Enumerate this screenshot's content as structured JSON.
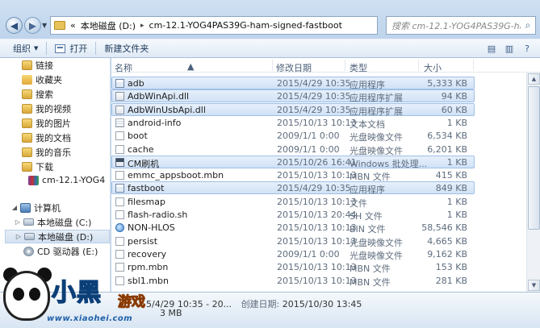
{
  "address": {
    "prefix": "«",
    "crumbs": [
      "本地磁盘 (D:)",
      "cm-12.1-YOG4PAS39G-ham-signed-fastboot"
    ],
    "separator": "▸"
  },
  "search": {
    "placeholder": "搜索 cm-12.1-YOG4PAS39G-ham-s..."
  },
  "toolbar": {
    "organize": "组织",
    "open": "打开",
    "new_folder": "新建文件夹"
  },
  "nav": {
    "items": [
      {
        "label": "链接",
        "icon": "link-folder-icon"
      },
      {
        "label": "收藏夹",
        "icon": "favorites-icon"
      },
      {
        "label": "搜索",
        "icon": "search-folder-icon"
      },
      {
        "label": "我的视频",
        "icon": "videos-icon"
      },
      {
        "label": "我的图片",
        "icon": "pictures-icon"
      },
      {
        "label": "我的文档",
        "icon": "documents-icon"
      },
      {
        "label": "我的音乐",
        "icon": "music-icon"
      },
      {
        "label": "下载",
        "icon": "downloads-icon"
      },
      {
        "label": "cm-12.1-YOG4",
        "icon": "rar-archive-icon"
      },
      {
        "label": "计算机",
        "icon": "computer-icon"
      },
      {
        "label": "本地磁盘 (C:)",
        "icon": "drive-icon"
      },
      {
        "label": "本地磁盘 (D:)",
        "icon": "drive-icon"
      },
      {
        "label": "CD 驱动器 (E:)",
        "icon": "cd-drive-icon"
      },
      {
        "label": "网",
        "icon": "network-icon"
      }
    ]
  },
  "columns": {
    "name": "名称",
    "date": "修改日期",
    "type": "类型",
    "size": "大小"
  },
  "files": [
    {
      "name": "adb",
      "date": "2015/4/29 10:35",
      "type": "应用程序",
      "size": "5,333 KB",
      "icon": "exe",
      "selected": true
    },
    {
      "name": "AdbWinApi.dll",
      "date": "2015/4/29 10:35",
      "type": "应用程序扩展",
      "size": "94 KB",
      "icon": "dll",
      "selected": true
    },
    {
      "name": "AdbWinUsbApi.dll",
      "date": "2015/4/29 10:35",
      "type": "应用程序扩展",
      "size": "60 KB",
      "icon": "dll",
      "selected": true
    },
    {
      "name": "android-info",
      "date": "2015/10/13 10:13",
      "type": "文本文档",
      "size": "1 KB",
      "icon": "txt",
      "selected": false
    },
    {
      "name": "boot",
      "date": "2009/1/1 0:00",
      "type": "光盘映像文件",
      "size": "6,534 KB",
      "icon": "file",
      "selected": false
    },
    {
      "name": "cache",
      "date": "2009/1/1 0:00",
      "type": "光盘映像文件",
      "size": "6,201 KB",
      "icon": "file",
      "selected": false
    },
    {
      "name": "CM刷机",
      "date": "2015/10/26 16:41",
      "type": "Windows 批处理...",
      "size": "1 KB",
      "icon": "bat",
      "selected": true
    },
    {
      "name": "emmc_appsboot.mbn",
      "date": "2015/10/13 10:13",
      "type": "MBN 文件",
      "size": "415 KB",
      "icon": "file",
      "selected": false
    },
    {
      "name": "fastboot",
      "date": "2015/4/29 10:35",
      "type": "应用程序",
      "size": "849 KB",
      "icon": "exe",
      "selected": true
    },
    {
      "name": "filesmap",
      "date": "2015/10/13 10:13",
      "type": "文件",
      "size": "1 KB",
      "icon": "file",
      "selected": false
    },
    {
      "name": "flash-radio.sh",
      "date": "2015/10/13 20:44",
      "type": "SH 文件",
      "size": "1 KB",
      "icon": "file",
      "selected": false
    },
    {
      "name": "NON-HLOS",
      "date": "2015/10/13 10:13",
      "type": "BIN 文件",
      "size": "58,546 KB",
      "icon": "web",
      "selected": false
    },
    {
      "name": "persist",
      "date": "2015/10/13 10:13",
      "type": "光盘映像文件",
      "size": "4,665 KB",
      "icon": "file",
      "selected": false
    },
    {
      "name": "recovery",
      "date": "2009/1/1 0:00",
      "type": "光盘映像文件",
      "size": "9,162 KB",
      "icon": "file",
      "selected": false
    },
    {
      "name": "rpm.mbn",
      "date": "2015/10/13 10:13",
      "type": "MBN 文件",
      "size": "153 KB",
      "icon": "file",
      "selected": false
    },
    {
      "name": "sbl1.mbn",
      "date": "2015/10/13 10:13",
      "type": "MBN 文件",
      "size": "281 KB",
      "icon": "file",
      "selected": false
    }
  ],
  "details": {
    "modified": "5/4/29 10:35 - 20...",
    "created_label": "创建日期:",
    "created": "2015/10/30 13:45",
    "size": "3 MB"
  },
  "watermark": {
    "word": "小黑",
    "word2": "游戏",
    "url": "www.xiaohei.com"
  },
  "colors": {
    "selection_fill": "#d1e2f6",
    "selection_border": "#9ec0e6",
    "frame": "#b9d1ea"
  }
}
